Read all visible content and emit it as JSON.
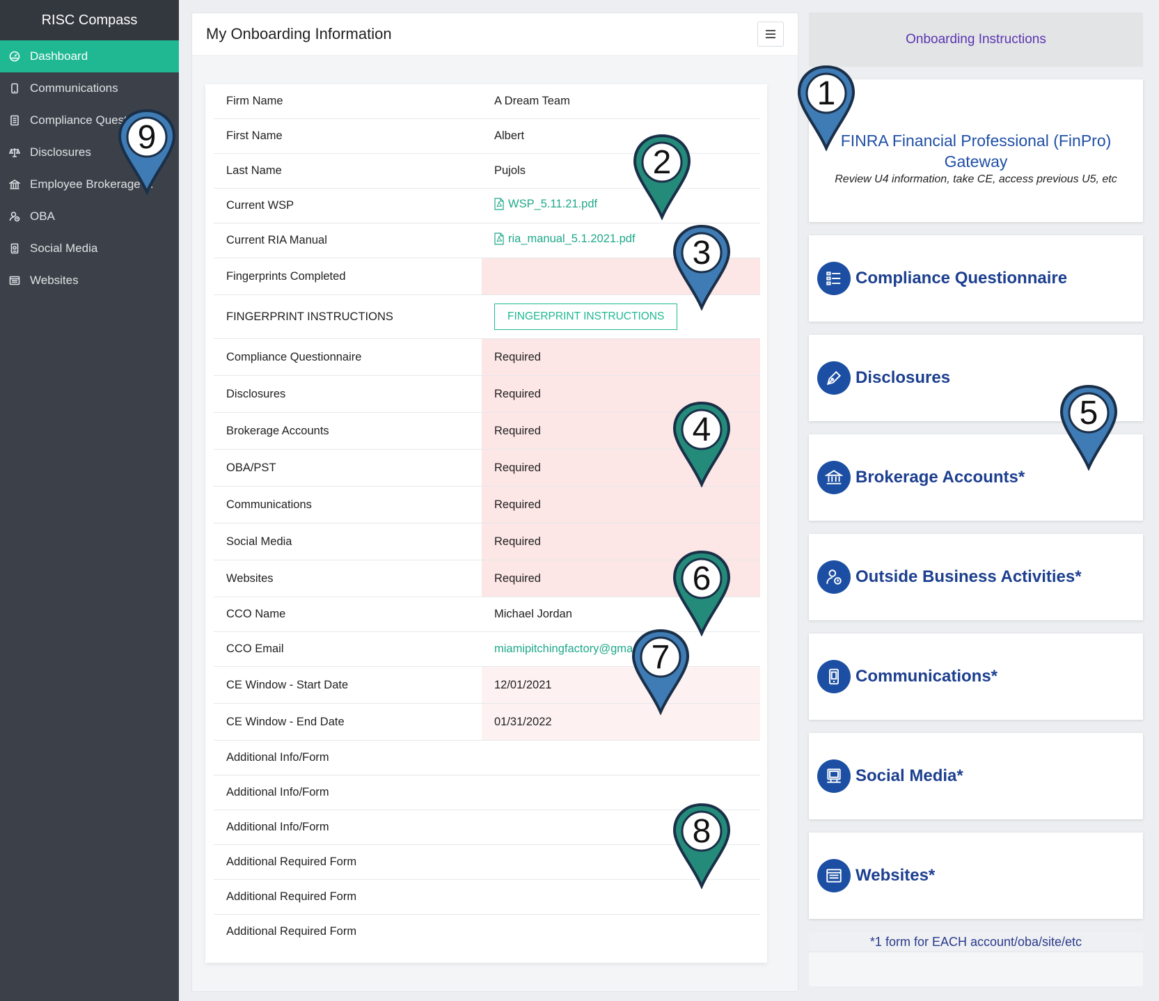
{
  "sidebar": {
    "brand": "RISC Compass",
    "items": [
      {
        "label": "Dashboard",
        "icon": "dashboard-icon",
        "active": true
      },
      {
        "label": "Communications",
        "icon": "phone-icon"
      },
      {
        "label": "Compliance Quest",
        "icon": "document-list-icon"
      },
      {
        "label": "Disclosures",
        "icon": "scale-icon"
      },
      {
        "label": "Employee Brokerage ...",
        "icon": "bank-icon"
      },
      {
        "label": "OBA",
        "icon": "user-clock-icon"
      },
      {
        "label": "Social Media",
        "icon": "social-phone-icon"
      },
      {
        "label": "Websites",
        "icon": "browser-icon"
      }
    ]
  },
  "main": {
    "title": "My Onboarding Information",
    "rows": {
      "firm_name": {
        "label": "Firm Name",
        "value": "A Dream Team"
      },
      "first_name": {
        "label": "First Name",
        "value": "Albert"
      },
      "last_name": {
        "label": "Last Name",
        "value": "Pujols"
      },
      "current_wsp": {
        "label": "Current WSP",
        "value": "WSP_5.11.21.pdf"
      },
      "ria_manual": {
        "label": "Current RIA Manual",
        "value": "ria_manual_5.1.2021.pdf"
      },
      "fingerprints": {
        "label": "Fingerprints Completed",
        "value": ""
      },
      "fp_instructions": {
        "label": "FINGERPRINT INSTRUCTIONS",
        "button": "FINGERPRINT INSTRUCTIONS"
      },
      "compliance_q": {
        "label": "Compliance Questionnaire",
        "value": "Required"
      },
      "disclosures": {
        "label": "Disclosures",
        "value": "Required"
      },
      "brokerage": {
        "label": "Brokerage Accounts",
        "value": "Required"
      },
      "oba": {
        "label": "OBA/PST",
        "value": "Required"
      },
      "communications": {
        "label": "Communications",
        "value": "Required"
      },
      "social_media": {
        "label": "Social Media",
        "value": "Required"
      },
      "websites": {
        "label": "Websites",
        "value": "Required"
      },
      "cco_name": {
        "label": "CCO Name",
        "value": "Michael Jordan"
      },
      "cco_email": {
        "label": "CCO Email",
        "value": "miamipitchingfactory@gma"
      },
      "ce_start": {
        "label": "CE Window - Start Date",
        "value": "12/01/2021"
      },
      "ce_end": {
        "label": "CE Window - End Date",
        "value": "01/31/2022"
      },
      "add_info_1": {
        "label": "Additional Info/Form"
      },
      "add_info_2": {
        "label": "Additional Info/Form"
      },
      "add_info_3": {
        "label": "Additional Info/Form"
      },
      "add_req_1": {
        "label": "Additional Required Form"
      },
      "add_req_2": {
        "label": "Additional Required Form"
      },
      "add_req_3": {
        "label": "Additional Required Form"
      }
    }
  },
  "right": {
    "header": "Onboarding Instructions",
    "finra_title": "FINRA Financial Professional (FinPro) Gateway",
    "finra_sub": "Review U4 information, take CE, access previous U5, etc",
    "items": [
      {
        "label": "Compliance Questionnaire",
        "icon": "list-icon"
      },
      {
        "label": "Disclosures",
        "icon": "pen-icon"
      },
      {
        "label": "Brokerage Accounts*",
        "icon": "bank-icon"
      },
      {
        "label": "Outside Business Activities*",
        "icon": "user-clock-icon"
      },
      {
        "label": "Communications*",
        "icon": "phone-icon"
      },
      {
        "label": "Social Media*",
        "icon": "monitor-icon"
      },
      {
        "label": "Websites*",
        "icon": "browser-icon"
      }
    ],
    "footnote": "*1 form for EACH account/oba/site/etc"
  },
  "pins": [
    "1",
    "2",
    "3",
    "4",
    "5",
    "6",
    "7",
    "8",
    "9"
  ],
  "colors": {
    "sidebar_bg": "#3c4149",
    "active_accent": "#1fb893",
    "required_red": "#c8102e",
    "link_green": "#1fa88a",
    "instruction_blue": "#1c4fa3",
    "pin_blue": "#3f7bb4",
    "pin_teal": "#248b7a"
  }
}
